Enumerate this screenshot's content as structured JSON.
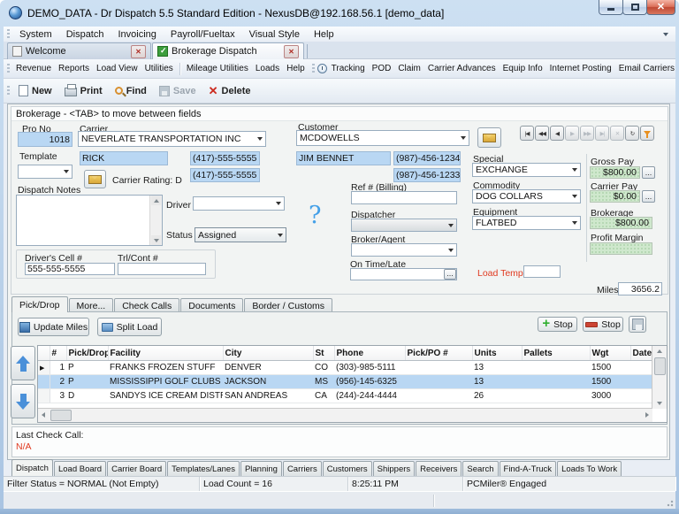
{
  "window": {
    "title": "DEMO_DATA - Dr Dispatch 5.5 Standard Edition - NexusDB@192.168.56.1 [demo_data]"
  },
  "menubar": {
    "items": [
      "System",
      "Dispatch",
      "Invoicing",
      "Payroll/Fueltax",
      "Visual Style",
      "Help"
    ]
  },
  "doc_tabs": [
    {
      "label": "Welcome"
    },
    {
      "label": "Brokerage Dispatch",
      "active": true
    }
  ],
  "toolbar_view": {
    "left": [
      "Revenue",
      "Reports",
      "Load View",
      "Utilities"
    ],
    "mid": [
      "Mileage Utilities",
      "Loads",
      "Help"
    ],
    "right": [
      "Tracking",
      "POD",
      "Claim",
      "Carrier Advances",
      "Equip Info",
      "Internet Posting",
      "Email Carriers"
    ]
  },
  "toolbar_actions": {
    "new": "New",
    "print": "Print",
    "find": "Find",
    "save": "Save",
    "delete": "Delete"
  },
  "form": {
    "group_title": "Brokerage - <TAB> to move between fields",
    "pro_no_label": "Pro No",
    "pro_no": "1018",
    "carrier_label": "Carrier",
    "carrier": "NEVERLATE TRANSPORTATION INC",
    "customer_label": "Customer",
    "customer": "MCDOWELLS",
    "template_label": "Template",
    "template": "",
    "carrier_contact": "RICK",
    "carrier_phone1": "(417)-555-5555",
    "carrier_phone2": "(417)-555-5555",
    "carrier_rating": "Carrier Rating: D",
    "customer_contact": "JIM BENNET",
    "customer_phone1": "(987)-456-1234",
    "customer_phone2": "(987)-456-1233",
    "dispatch_notes_label": "Dispatch Notes",
    "dispatch_notes": "",
    "driver_label": "Driver",
    "driver": "",
    "status_label": "Status",
    "status": "Assigned",
    "help_mark": "?",
    "ref_billing_label": "Ref # (Billing)",
    "ref_billing": "",
    "dispatcher_label": "Dispatcher",
    "dispatcher": "",
    "broker_agent_label": "Broker/Agent",
    "broker_agent": "",
    "on_time_late_label": "On Time/Late",
    "on_time_late": "",
    "special_label": "Special",
    "special": "EXCHANGE",
    "commodity_label": "Commodity",
    "commodity": "DOG COLLARS",
    "equipment_label": "Equipment",
    "equipment": "FLATBED",
    "gross_pay_label": "Gross Pay",
    "gross_pay": "$800.00",
    "carrier_pay_label": "Carrier Pay",
    "carrier_pay": "$0.00",
    "brokerage_label": "Brokerage",
    "brokerage": "$800.00",
    "profit_margin_label": "Profit Margin",
    "profit_margin": "",
    "load_temp_label": "Load Temp",
    "load_temp": "",
    "miles_label": "Miles",
    "miles": "3656.2",
    "drivers_cell_label": "Driver's Cell #",
    "drivers_cell": "555-555-5555",
    "trl_cont_label": "Trl/Cont #",
    "trl_cont": ""
  },
  "stops": {
    "tabs": [
      "Pick/Drop",
      "More...",
      "Check Calls",
      "Documents",
      "Border / Customs"
    ],
    "update_miles": "Update Miles",
    "split_load": "Split Load",
    "add_stop": "Stop",
    "remove_stop": "Stop",
    "grid": {
      "columns": [
        "#",
        "Pick/Drop",
        "Facility",
        "City",
        "St",
        "Phone",
        "Pick/PO #",
        "Units",
        "Pallets",
        "Wgt",
        "Date"
      ],
      "rows": [
        {
          "n": "1",
          "pd": "P",
          "facility": "FRANKS FROZEN STUFF",
          "city": "DENVER",
          "st": "CO",
          "phone": "(303)-985-5111",
          "po": "",
          "units": "13",
          "pallets": "",
          "wgt": "1500",
          "date": "",
          "current": true
        },
        {
          "n": "2",
          "pd": "P",
          "facility": "MISSISSIPPI GOLF CLUBS & S",
          "city": "JACKSON",
          "st": "MS",
          "phone": "(956)-145-6325",
          "po": "",
          "units": "13",
          "pallets": "",
          "wgt": "1500",
          "date": "",
          "selected": true
        },
        {
          "n": "3",
          "pd": "D",
          "facility": "SANDYS ICE CREAM DISTRIB",
          "city": "SAN ANDREAS",
          "st": "CA",
          "phone": "(244)-244-4444",
          "po": "",
          "units": "26",
          "pallets": "",
          "wgt": "3000",
          "date": ""
        }
      ]
    }
  },
  "check_call": {
    "label": "Last Check Call:",
    "value": "N/A"
  },
  "bottom_tabs": [
    {
      "label": "Dispatch",
      "active": true
    },
    {
      "label": "Load Board"
    },
    {
      "label": "Carrier Board"
    },
    {
      "label": "Templates/Lanes"
    },
    {
      "label": "Planning"
    },
    {
      "label": "Carriers"
    },
    {
      "label": "Customers"
    },
    {
      "label": "Shippers"
    },
    {
      "label": "Receivers"
    },
    {
      "label": "Search"
    },
    {
      "label": "Find-A-Truck"
    },
    {
      "label": "Loads To Work"
    }
  ],
  "status_bar": {
    "filter": "Filter Status = NORMAL (Not Empty)",
    "load_count": "Load Count = 16",
    "time": "8:25:11 PM",
    "engine": "PCMiler® Engaged"
  }
}
